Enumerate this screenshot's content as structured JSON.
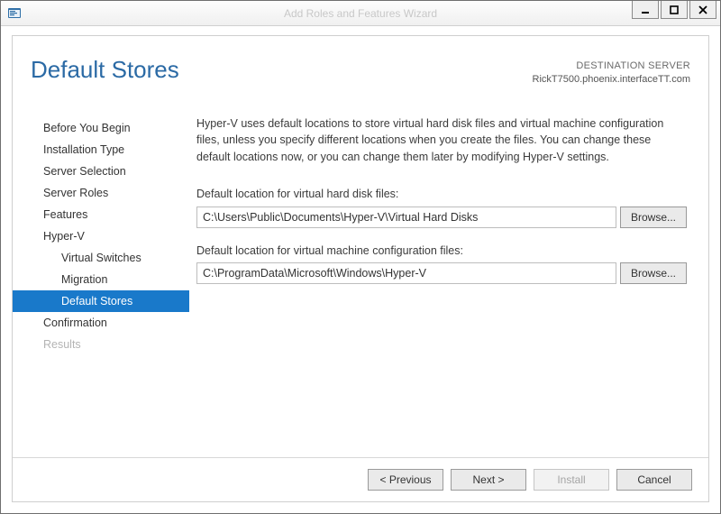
{
  "window": {
    "title": "Add Roles and Features Wizard"
  },
  "header": {
    "page_title": "Default Stores",
    "destination_label": "DESTINATION SERVER",
    "destination_value": "RickT7500.phoenix.interfaceTT.com"
  },
  "sidebar": {
    "items": [
      {
        "label": "Before You Begin",
        "level": 0,
        "state": "normal"
      },
      {
        "label": "Installation Type",
        "level": 0,
        "state": "normal"
      },
      {
        "label": "Server Selection",
        "level": 0,
        "state": "normal"
      },
      {
        "label": "Server Roles",
        "level": 0,
        "state": "normal"
      },
      {
        "label": "Features",
        "level": 0,
        "state": "normal"
      },
      {
        "label": "Hyper-V",
        "level": 0,
        "state": "normal"
      },
      {
        "label": "Virtual Switches",
        "level": 1,
        "state": "normal"
      },
      {
        "label": "Migration",
        "level": 1,
        "state": "normal"
      },
      {
        "label": "Default Stores",
        "level": 1,
        "state": "selected"
      },
      {
        "label": "Confirmation",
        "level": 0,
        "state": "normal"
      },
      {
        "label": "Results",
        "level": 0,
        "state": "disabled"
      }
    ]
  },
  "main": {
    "description": "Hyper-V uses default locations to store virtual hard disk files and virtual machine configuration files, unless you specify different locations when you create the files. You can change these default locations now, or you can change them later by modifying Hyper-V settings.",
    "vhd_label": "Default location for virtual hard disk files:",
    "vhd_value": "C:\\Users\\Public\\Documents\\Hyper-V\\Virtual Hard Disks",
    "vm_label": "Default location for virtual machine configuration files:",
    "vm_value": "C:\\ProgramData\\Microsoft\\Windows\\Hyper-V",
    "browse_label": "Browse..."
  },
  "footer": {
    "previous": "< Previous",
    "next": "Next >",
    "install": "Install",
    "cancel": "Cancel"
  }
}
